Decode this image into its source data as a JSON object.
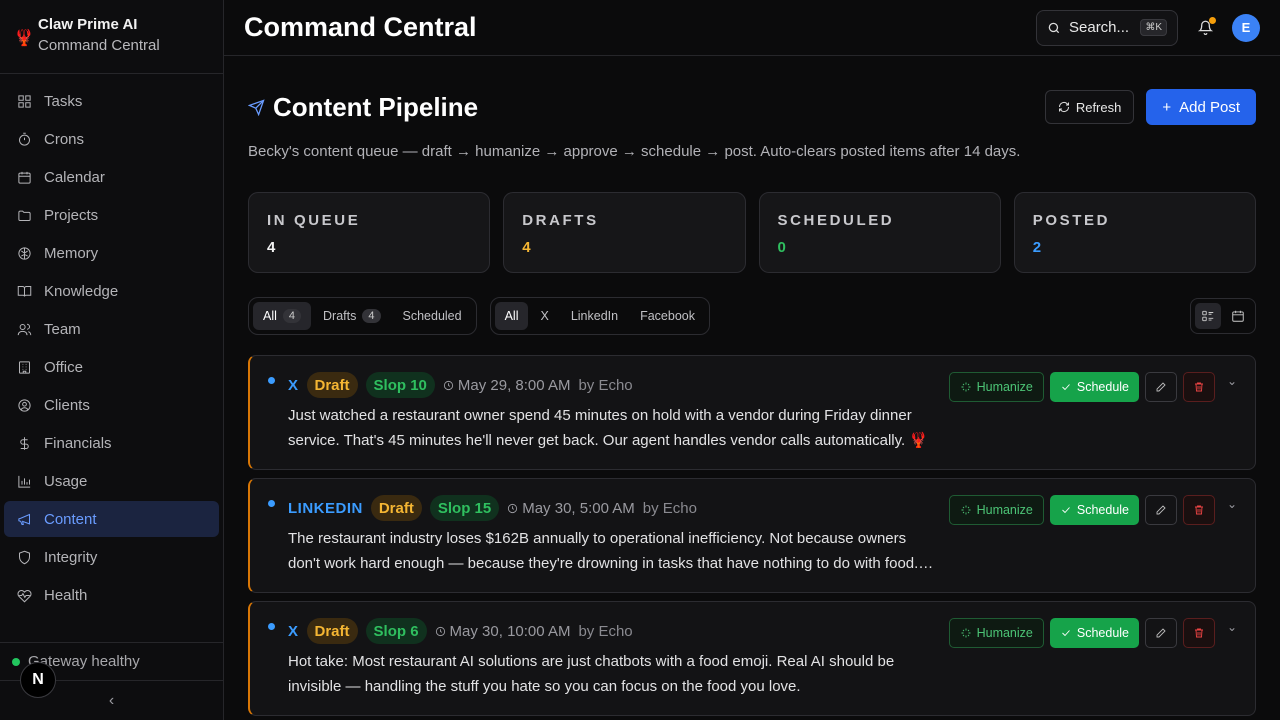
{
  "app": {
    "name": "Claw Prime AI",
    "subtitle": "Command Central"
  },
  "sidebar": {
    "items": [
      {
        "label": "Tasks",
        "icon": "grid-icon"
      },
      {
        "label": "Crons",
        "icon": "stopwatch-icon"
      },
      {
        "label": "Calendar",
        "icon": "calendar-icon"
      },
      {
        "label": "Projects",
        "icon": "folder-icon"
      },
      {
        "label": "Memory",
        "icon": "brain-icon"
      },
      {
        "label": "Knowledge",
        "icon": "book-icon"
      },
      {
        "label": "Team",
        "icon": "users-icon"
      },
      {
        "label": "Office",
        "icon": "building-icon"
      },
      {
        "label": "Clients",
        "icon": "user-circle-icon"
      },
      {
        "label": "Financials",
        "icon": "dollar-icon"
      },
      {
        "label": "Usage",
        "icon": "bar-chart-icon"
      },
      {
        "label": "Content",
        "icon": "megaphone-icon",
        "active": true
      },
      {
        "label": "Integrity",
        "icon": "shield-icon"
      },
      {
        "label": "Health",
        "icon": "heart-pulse-icon"
      }
    ],
    "gateway_status": "Gateway healthy",
    "badge_letter": "N"
  },
  "topbar": {
    "title": "Command Central",
    "search_label": "Search...",
    "search_kbd": "⌘K",
    "avatar_letter": "E"
  },
  "page": {
    "title": "Content Pipeline",
    "refresh_label": "Refresh",
    "add_label": "Add Post",
    "subtitle": "Becky's content queue — draft → humanize → approve → schedule → post. Auto-clears posted items after 14 days."
  },
  "stats": [
    {
      "label": "IN QUEUE",
      "value": "4",
      "color": "#f2f2f2"
    },
    {
      "label": "DRAFTS",
      "value": "4",
      "color": "#f5b633"
    },
    {
      "label": "SCHEDULED",
      "value": "0",
      "color": "#2fbf5f"
    },
    {
      "label": "POSTED",
      "value": "2",
      "color": "#3b9cff"
    }
  ],
  "status_filter": [
    {
      "label": "All",
      "count": "4",
      "active": true
    },
    {
      "label": "Drafts",
      "count": "4"
    },
    {
      "label": "Scheduled",
      "count": ""
    }
  ],
  "platform_filter": [
    {
      "label": "All",
      "active": true
    },
    {
      "label": "X"
    },
    {
      "label": "LinkedIn"
    },
    {
      "label": "Facebook"
    }
  ],
  "posts": [
    {
      "platform": "X",
      "status": "Draft",
      "slop": "Slop 10",
      "time": "May 29, 8:00 AM",
      "by": "by Echo",
      "body": "Just watched a restaurant owner spend 45 minutes on hold with a vendor during Friday dinner service. That's 45 minutes he'll never get back. Our agent handles vendor calls automatically. 🦞"
    },
    {
      "platform": "LINKEDIN",
      "status": "Draft",
      "slop": "Slop 15",
      "time": "May 30, 5:00 AM",
      "by": "by Echo",
      "body": "The restaurant industry loses $162B annually to operational inefficiency. Not because owners don't work hard enough — because they're drowning in tasks that have nothing to do with food. Every hour spent on admin is an hour not spent on guests."
    },
    {
      "platform": "X",
      "status": "Draft",
      "slop": "Slop 6",
      "time": "May 30, 10:00 AM",
      "by": "by Echo",
      "body": "Hot take: Most restaurant AI solutions are just chatbots with a food emoji. Real AI should be invisible — handling the stuff you hate so you can focus on the food you love."
    }
  ],
  "post_actions": {
    "humanize": "Humanize",
    "schedule": "Schedule"
  }
}
